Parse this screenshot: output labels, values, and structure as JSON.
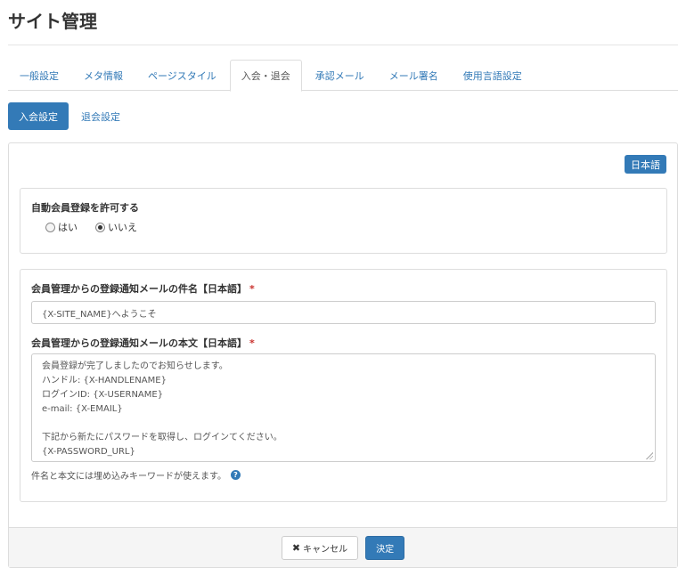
{
  "header": {
    "title": "サイト管理"
  },
  "tabs": [
    {
      "label": "一般設定",
      "active": false
    },
    {
      "label": "メタ情報",
      "active": false
    },
    {
      "label": "ページスタイル",
      "active": false
    },
    {
      "label": "入会・退会",
      "active": true
    },
    {
      "label": "承認メール",
      "active": false
    },
    {
      "label": "メール署名",
      "active": false
    },
    {
      "label": "使用言語設定",
      "active": false
    }
  ],
  "pills": [
    {
      "label": "入会設定",
      "active": true
    },
    {
      "label": "退会設定",
      "active": false
    }
  ],
  "panel": {
    "language_badge": "日本語",
    "auto_register": {
      "label": "自動会員登録を許可する",
      "options": [
        {
          "label": "はい",
          "checked": false
        },
        {
          "label": "いいえ",
          "checked": true
        }
      ]
    },
    "mail": {
      "subject_label": "会員管理からの登録通知メールの件名【日本語】",
      "subject_required": "*",
      "subject_value": "{X-SITE_NAME}へようこそ",
      "body_label": "会員管理からの登録通知メールの本文【日本語】",
      "body_required": "*",
      "body_lines": [
        "会員登録が完了しましたのでお知らせします。",
        "ハンドル: {X-HANDLENAME}",
        "ログインID: {X-USERNAME}",
        "e-mail: {X-EMAIL}",
        "",
        "下記から新たにパスワードを取得し、ログインてください。",
        "{X-PASSWORD_URL}"
      ],
      "help_text": "件名と本文には埋め込みキーワードが使えます。",
      "help_icon": "question-circle-icon"
    }
  },
  "footer": {
    "cancel_label": "キャンセル",
    "cancel_icon": "close-icon",
    "submit_label": "決定"
  }
}
